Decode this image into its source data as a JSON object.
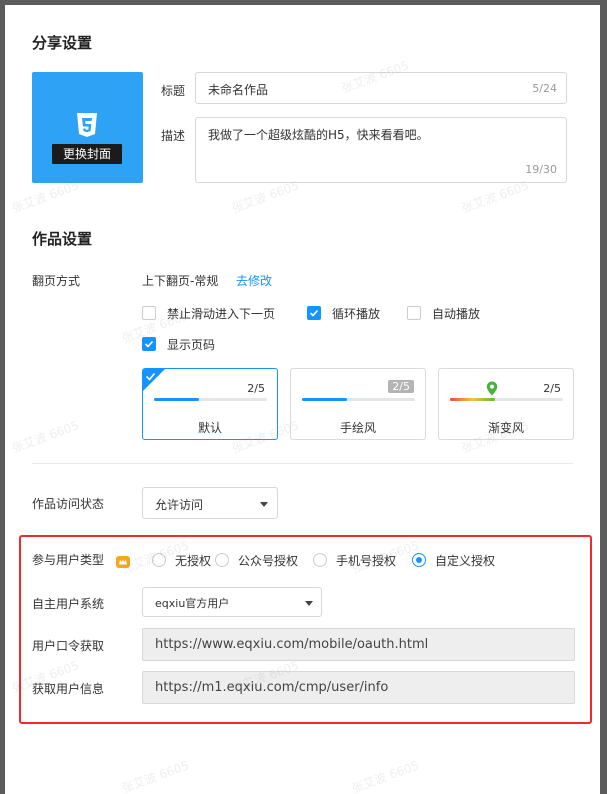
{
  "share": {
    "title": "分享设置",
    "cover_button": "更换封面",
    "title_label": "标题",
    "title_value": "未命名作品",
    "title_count": "5/24",
    "desc_label": "描述",
    "desc_value": "我做了一个超级炫酷的H5，快来看看吧。",
    "desc_count": "19/30"
  },
  "work": {
    "title": "作品设置",
    "flip_label": "翻页方式",
    "flip_value": "上下翻页-常规",
    "flip_link": "去修改",
    "options": [
      {
        "label": "禁止滑动进入下一页",
        "checked": false
      },
      {
        "label": "循环播放",
        "checked": true
      },
      {
        "label": "自动播放",
        "checked": false
      },
      {
        "label": "显示页码",
        "checked": true
      }
    ],
    "styles": [
      {
        "name": "默认",
        "page": "2/5",
        "progress": 0.4,
        "selected": true
      },
      {
        "name": "手绘风",
        "page": "2/5",
        "progress": 0.4,
        "selected": false
      },
      {
        "name": "渐变风",
        "page": "2/5",
        "progress": 0.4,
        "selected": false
      }
    ],
    "access_label": "作品访问状态",
    "access_value": "允许访问"
  },
  "auth": {
    "type_label": "参与用户类型",
    "types": [
      {
        "label": "无授权",
        "selected": false
      },
      {
        "label": "公众号授权",
        "selected": false
      },
      {
        "label": "手机号授权",
        "selected": false
      },
      {
        "label": "自定义授权",
        "selected": true
      }
    ],
    "system_label": "自主用户系统",
    "system_value": "eqxiu官方用户",
    "token_label": "用户口令获取",
    "token_url": "https://www.eqxiu.com/mobile/oauth.html",
    "info_label": "获取用户信息",
    "info_url": "https://m1.eqxiu.com/cmp/user/info"
  },
  "watermark_text": "张艾波 6605",
  "colors": {
    "accent": "#1593ff",
    "highlight": "#ef2a2a",
    "cover": "#2ea3f5"
  }
}
